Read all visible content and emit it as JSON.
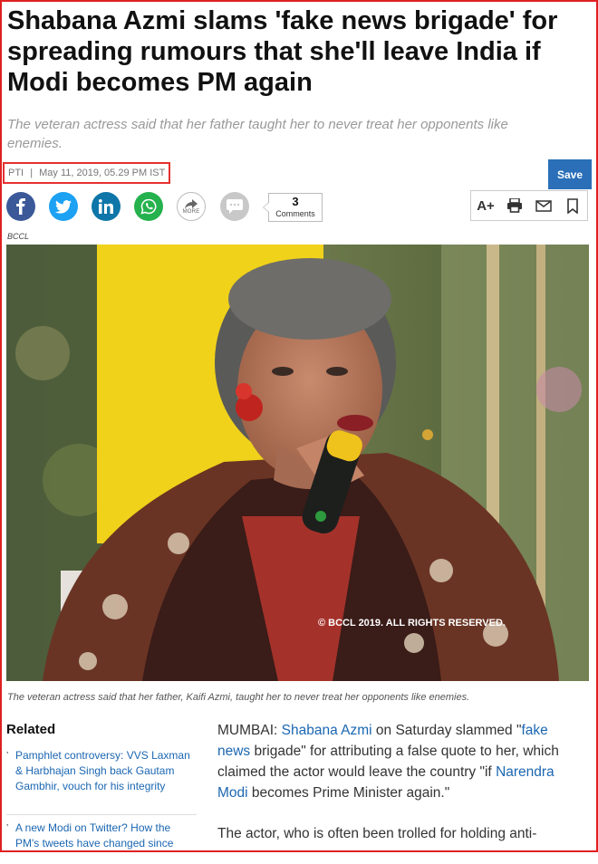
{
  "headline": "Shabana Azmi slams 'fake news brigade' for spreading rumours that she'll leave India if Modi becomes PM again",
  "subtitle": "The veteran actress said that her father taught her to never treat her opponents like enemies.",
  "byline": {
    "source": "PTI",
    "separator": "|",
    "date": "May 11, 2019, 05.29 PM IST"
  },
  "share": {
    "more_label": "MORE",
    "comments_count": "3",
    "comments_label": "Comments",
    "icons": [
      "facebook-icon",
      "twitter-icon",
      "linkedin-icon",
      "whatsapp-icon",
      "share-more-icon",
      "comment-icon"
    ]
  },
  "save_label": "Save",
  "tools": {
    "font_size_label": "A+",
    "icons": [
      "font-size-icon",
      "print-icon",
      "email-icon",
      "bookmark-icon"
    ]
  },
  "photo": {
    "credit": "BCCL",
    "watermark": "© BCCL 2019. ALL RIGHTS RESERVED.",
    "caption": "The veteran actress said that her father, Kaifi Azmi, taught her to never treat her opponents like enemies."
  },
  "related": {
    "title": "Related",
    "items": [
      "Pamphlet controversy: VVS Laxman & Harbhajan Singh back Gautam Gambhir, vouch for his integrity",
      "A new Modi on Twitter? How the PM's tweets have changed since"
    ]
  },
  "article": {
    "p1_prefix": "MUMBAI: ",
    "p1_link1": "Shabana Azmi",
    "p1_mid1": " on Saturday slammed \"",
    "p1_link2": "fake news",
    "p1_mid2": " brigade\" for attributing a false quote to her, which claimed the actor would leave the country \"if ",
    "p1_link3": "Narendra Modi",
    "p1_suffix": " becomes Prime Minister again.\"",
    "p2": "The actor, who is often been trolled for holding anti-"
  },
  "colors": {
    "link": "#1b66b1",
    "save_button": "#2a6fb8",
    "highlight_border": "#e53030"
  }
}
